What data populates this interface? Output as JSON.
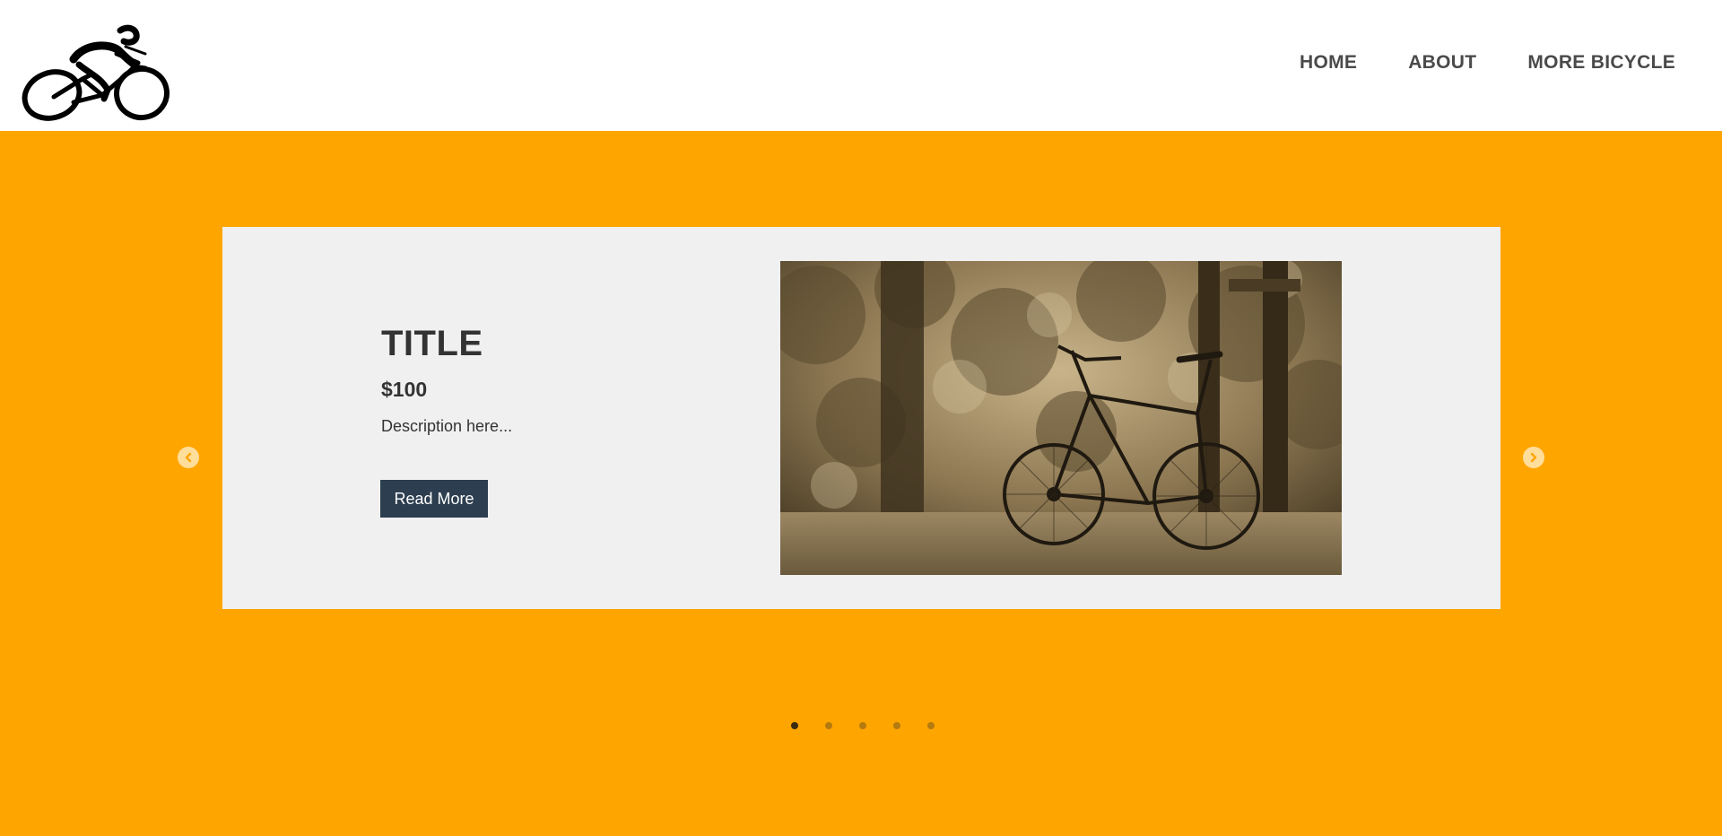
{
  "header": {
    "logo_icon": "cyclist-logo-icon",
    "nav": [
      {
        "label": "HOME"
      },
      {
        "label": "ABOUT"
      },
      {
        "label": "MORE BICYCLE"
      }
    ]
  },
  "hero": {
    "background_color": "#ffa500",
    "slide": {
      "title": "TITLE",
      "price": "$100",
      "description": "Description here...",
      "button_label": "Read More",
      "image_icon": "bicycle-photo"
    },
    "prev_icon": "chevron-left-icon",
    "next_icon": "chevron-right-icon",
    "pagination": {
      "total": 5,
      "active_index": 0
    }
  },
  "colors": {
    "accent": "#ffa500",
    "button": "#2c3e50",
    "card": "#f0f0f0",
    "text": "#333333"
  }
}
